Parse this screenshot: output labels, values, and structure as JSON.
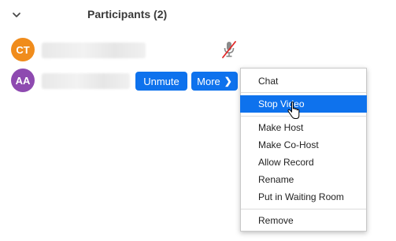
{
  "header": {
    "title": "Participants (2)",
    "collapse_icon": "chevron-down-icon"
  },
  "participants": [
    {
      "initials": "CT",
      "avatar_color": "#f08c1c",
      "name": "",
      "status_icon": "muted-mic-icon"
    },
    {
      "initials": "AA",
      "avatar_color": "#8e4ab0",
      "name": "",
      "actions": {
        "unmute_label": "Unmute",
        "more_label": "More",
        "more_icon": "chevron-right-icon"
      }
    }
  ],
  "context_menu": {
    "items": [
      {
        "label": "Chat",
        "selected": false
      },
      {
        "label": "Stop Video",
        "selected": true
      },
      {
        "label": "Make Host",
        "selected": false
      },
      {
        "label": "Make Co-Host",
        "selected": false
      },
      {
        "label": "Allow Record",
        "selected": false
      },
      {
        "label": "Rename",
        "selected": false
      },
      {
        "label": "Put in Waiting Room",
        "selected": false
      },
      {
        "label": "Remove",
        "selected": false
      }
    ]
  },
  "colors": {
    "accent": "#0e72ed",
    "muted_red": "#e02828"
  },
  "cursor_icon": "pointer-cursor-icon"
}
